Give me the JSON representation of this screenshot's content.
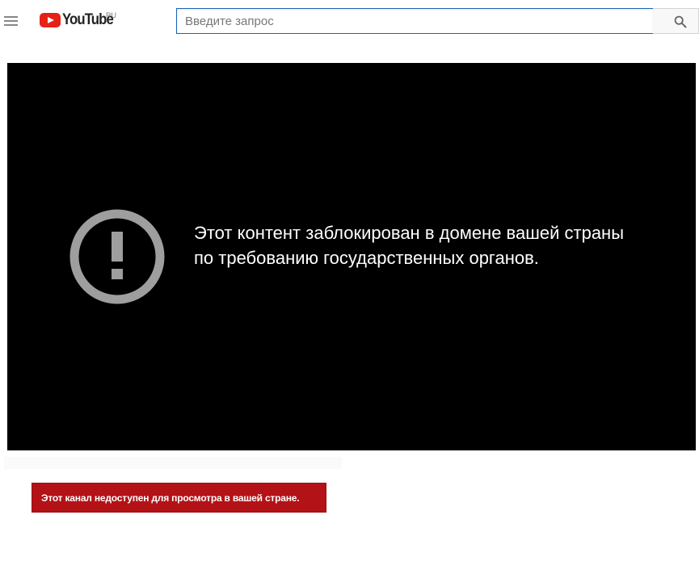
{
  "header": {
    "logo_text": "YouTube",
    "region_label": "RU",
    "search_placeholder": "Введите запрос"
  },
  "player": {
    "message": "Этот контент заблокирован в домене вашей страны по требованию государственных органов."
  },
  "channel_notice": {
    "text": "Этот канал недоступен для просмотра в вашей стране."
  },
  "colors": {
    "brand_red": "#e62117",
    "alert_red": "#b31217",
    "player_bg": "#000000",
    "alert_icon": "#9e9e9e"
  }
}
